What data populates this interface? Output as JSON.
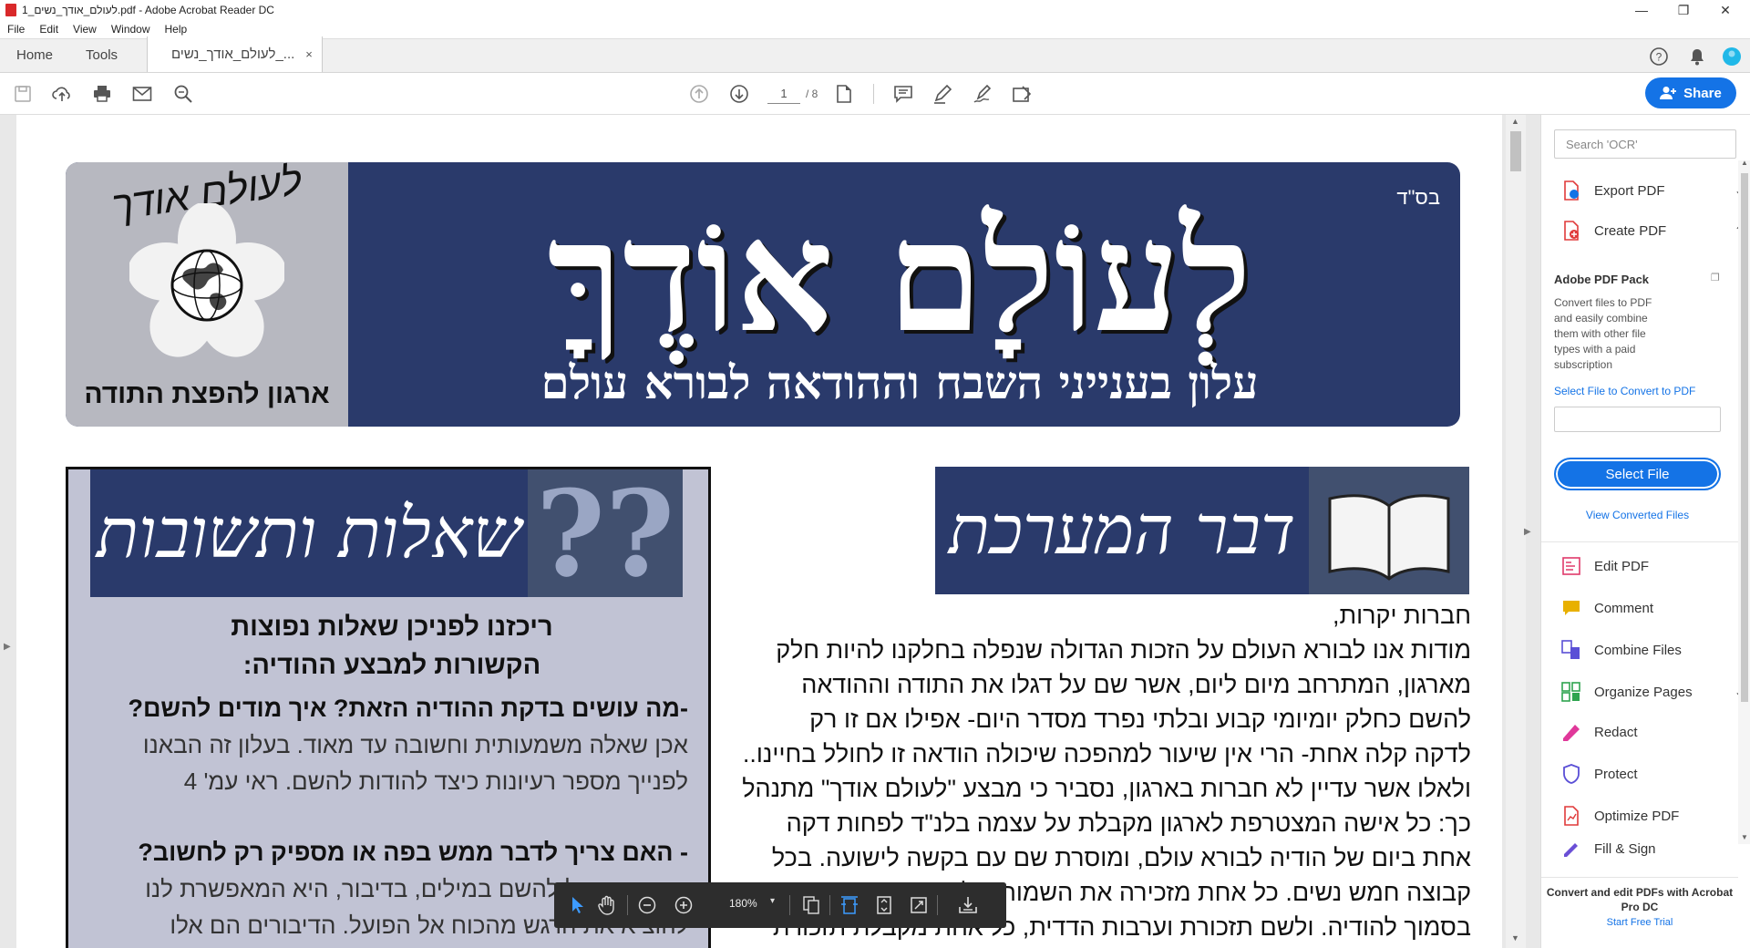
{
  "window": {
    "title": "לעולם_אודך_נשים_1.pdf - Adobe Acrobat Reader DC",
    "minimize": "—",
    "maximize": "❐",
    "close": "✕"
  },
  "menu": [
    "File",
    "Edit",
    "View",
    "Window",
    "Help"
  ],
  "tabs": {
    "home": "Home",
    "tools": "Tools",
    "doc": "לעולם_אודך_נשים_...",
    "close": "×"
  },
  "toolbar": {
    "page_current": "1",
    "page_total": "/ 8",
    "share_label": "Share"
  },
  "panel": {
    "search_placeholder": "Search 'OCR'",
    "tools": [
      {
        "label": "Export PDF",
        "icon": "export-pdf-icon",
        "color": "#1473e6"
      },
      {
        "label": "Create PDF",
        "icon": "create-pdf-icon",
        "color": "#e03a3a"
      },
      {
        "label": "Edit PDF",
        "icon": "edit-pdf-icon",
        "color": "#e03a6a"
      },
      {
        "label": "Comment",
        "icon": "comment-icon",
        "color": "#e8b000"
      },
      {
        "label": "Combine Files",
        "icon": "combine-files-icon",
        "color": "#5a4fd6"
      },
      {
        "label": "Organize Pages",
        "icon": "organize-pages-icon",
        "color": "#2ea44f"
      },
      {
        "label": "Redact",
        "icon": "redact-icon",
        "color": "#e0389a"
      },
      {
        "label": "Protect",
        "icon": "protect-icon",
        "color": "#5a4fd6"
      },
      {
        "label": "Optimize PDF",
        "icon": "optimize-pdf-icon",
        "color": "#e03a3a"
      },
      {
        "label": "Fill & Sign",
        "icon": "fill-sign-icon",
        "color": "#6a4fd6"
      }
    ],
    "pack_title": "Adobe PDF Pack",
    "pack_desc": "Convert files to PDF and easily combine them with other file types with a paid subscription",
    "select_label": "Select File to Convert to PDF",
    "select_button": "Select File",
    "view_converted": "View Converted Files",
    "promo": "Convert and edit PDFs with Acrobat Pro DC",
    "trial": "Start Free Trial"
  },
  "floating_toolbar": {
    "zoom": "180%"
  },
  "document": {
    "bsd": "בס\"ד",
    "main_title": "לְעוֹלָם אוֹדֶךָּ",
    "subtitle": "עלון בענייני השבח וההודאה לבורא עולם",
    "logo_script": "לעולם אודך",
    "org_name": "ארגון להפצת התודה",
    "qa_title": "שאלות ותשובות",
    "qa_heading_1": "ריכזנו לפניכן שאלות נפוצות",
    "qa_heading_2": "הקשורות למבצע ההודיה:",
    "qa_q1": "-מה עושים בדקת ההודיה הזאת? איך מודים להשם?",
    "qa_a1_1": "אכן שאלה משמעותית וחשובה עד מאוד. בעלון זה הבאנו",
    "qa_a1_2": "לפנייך מספר רעיונות כיצד להודות להשם. ראי עמ' 4",
    "qa_q2": "- האם צריך לדבר ממש בפה או מספיק רק לחשוב?",
    "qa_a2_1": "הודיה בפועל להשם במילים, בדיבור, היא המאפשרת לנו",
    "qa_a2_2": "להוציא את הרגש מהכוח אל הפועל. הדיבורים הם אלו שיבראו",
    "editor_title": "דבר המערכת",
    "article_greet": "חברות יקרות,",
    "article_lines": [
      "מודות אנו לבורא העולם על הזכות הגדולה שנפלה בחלקנו להיות חלק",
      "מארגון, המתרחב מיום ליום, אשר שם על דגלו את התודה וההודאה",
      "להשם  כחלק יומיומי קבוע ובלתי נפרד מסדר היום- אפילו אם זו רק",
      "לדקה קלה אחת- הרי אין שיעור למהפכה שיכולה הודאה זו לחולל בחיינו..",
      "ולאלו אשר עדיין לא חברות בארגון, נסביר כי מבצע \"לעולם אודך\" מתנהל",
      "כך: כל אישה המצטרפת לארגון מקבלת על עצמה בלנ\"ד לפחות דקה",
      "אחת ביום של הודיה לבורא עולם, ומוסרת שם עם בקשה לישועה. בכל",
      "קבוצה חמש נשים. כל אחת מזכירה את השמות של חברותיה בקבוצה",
      "בסמוך להודיה. ולשם תזכורת וערבות הדדית, כל אחת מקבלת תזכורת"
    ]
  }
}
